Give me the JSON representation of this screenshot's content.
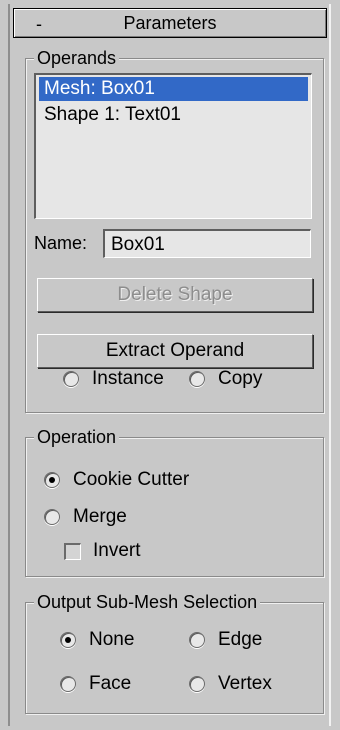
{
  "panel": {
    "collapse_sign": "-",
    "title": "Parameters"
  },
  "operands": {
    "legend": "Operands",
    "items": [
      {
        "label": "Mesh: Box01",
        "selected": true
      },
      {
        "label": "Shape 1: Text01",
        "selected": false
      }
    ],
    "name_label": "Name:",
    "name_value": "Box01",
    "delete_shape_label": "Delete Shape",
    "extract_operand_label": "Extract Operand",
    "copy_mode": {
      "instance_label": "Instance",
      "copy_label": "Copy",
      "selected": "none"
    }
  },
  "operation": {
    "legend": "Operation",
    "cookie_cutter_label": "Cookie Cutter",
    "merge_label": "Merge",
    "invert_label": "Invert",
    "selected": "cookie_cutter",
    "invert_checked": false
  },
  "output": {
    "legend": "Output Sub-Mesh Selection",
    "none_label": "None",
    "edge_label": "Edge",
    "face_label": "Face",
    "vertex_label": "Vertex",
    "selected": "none"
  }
}
